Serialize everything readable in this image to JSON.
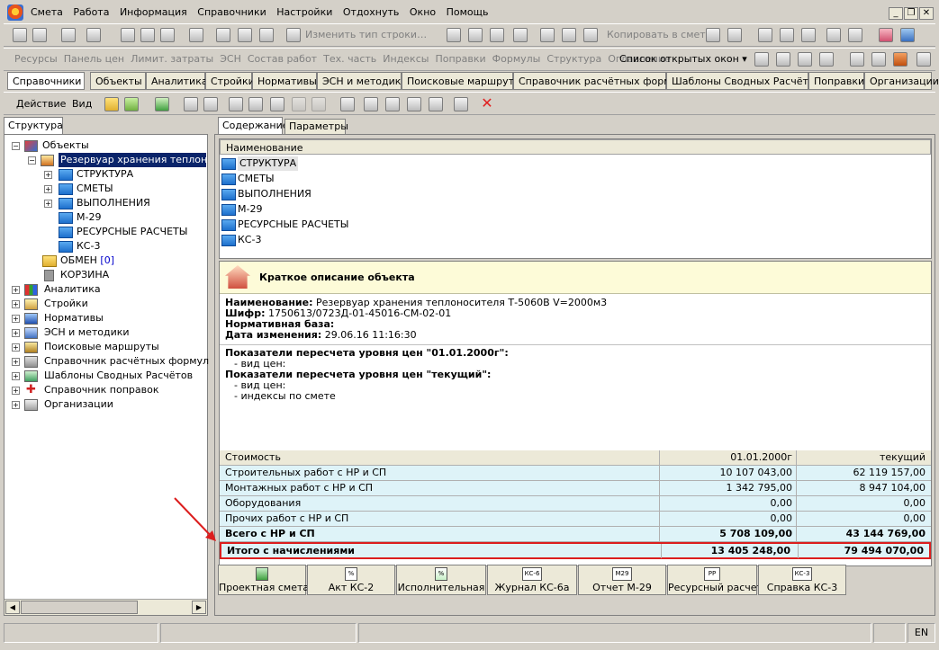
{
  "menubar": {
    "items": [
      "Смета",
      "Работа",
      "Информация",
      "Справочники",
      "Настройки",
      "Отдохнуть",
      "Окно",
      "Помощь"
    ]
  },
  "toolbar1": {
    "change_row_type": "Изменить тип строки…",
    "copy_to_estimate": "Копировать в смету"
  },
  "toolbar2": {
    "items": [
      "Ресурсы",
      "Панель цен",
      "Лимит. затраты",
      "ЭСН",
      "Состав работ",
      "Тех. часть",
      "Индексы",
      "Поправки",
      "Формулы",
      "Структура",
      "Оглавление"
    ],
    "open_windows": "Список открытых окон"
  },
  "ref_tabs": [
    "Справочники",
    "Объекты",
    "Аналитика",
    "Стройки",
    "Нормативы",
    "ЭСН и методики",
    "Поисковые маршруты",
    "Справочник расчётных формул",
    "Шаблоны Сводных Расчётов",
    "Поправки",
    "Организации"
  ],
  "action_bar": {
    "action": "Действие",
    "view": "Вид"
  },
  "left": {
    "tab": "Структура",
    "tree": {
      "objects": "Объекты",
      "reservoir": "Резервуар хранения теплоноси",
      "children": [
        "СТРУКТУРА",
        "СМЕТЫ",
        "ВЫПОЛНЕНИЯ",
        "М-29",
        "РЕСУРСНЫЕ РАСЧЕТЫ",
        "КС-3"
      ],
      "exchange": "ОБМЕН",
      "exchange_count": "[0]",
      "basket": "КОРЗИНА",
      "roots": [
        "Аналитика",
        "Стройки",
        "Нормативы",
        "ЭСН и методики",
        "Поисковые маршруты",
        "Справочник расчётных формул",
        "Шаблоны Сводных Расчётов",
        "Справочник поправок",
        "Организации"
      ]
    }
  },
  "right": {
    "tabs": [
      "Содержание",
      "Параметры"
    ],
    "list_header": "Наименование",
    "list": [
      "СТРУКТУРА",
      "СМЕТЫ",
      "ВЫПОЛНЕНИЯ",
      "М-29",
      "РЕСУРСНЫЕ РАСЧЕТЫ",
      "КС-3"
    ],
    "desc_title": "Краткое описание объекта",
    "desc": {
      "name_label": "Наименование:",
      "name_value": "Резервуар хранения теплоносителя Т-5060В V=2000м3",
      "code_label": "Шифр:",
      "code_value": "1750613/0723Д-01-45016-СМ-02-01",
      "base_label": "Нормативная база:",
      "date_label": "Дата изменения:",
      "date_value": "29.06.16 11:16:30"
    },
    "indicators": {
      "h1": "Показатели пересчета уровня цен \"01.01.2000г\":",
      "h1_items": [
        "- вид цен:"
      ],
      "h2": "Показатели пересчета уровня цен \"текущий\":",
      "h2_items": [
        "- вид цен:",
        "- индексы по смете"
      ]
    },
    "cost": {
      "headers": [
        "Стоимость",
        "01.01.2000г",
        "текущий"
      ],
      "rows": [
        {
          "name": "Строительных работ с НР и СП",
          "base": "10 107 043,00",
          "current": "62 119 157,00"
        },
        {
          "name": "Монтажных работ с НР и СП",
          "base": "1 342 795,00",
          "current": "8 947 104,00"
        },
        {
          "name": "Оборудования",
          "base": "0,00",
          "current": "0,00"
        },
        {
          "name": "Прочих работ с НР и СП",
          "base": "0,00",
          "current": "0,00"
        },
        {
          "name": "Всего с НР и СП",
          "base": "5 708 109,00",
          "current": "43 144 769,00"
        },
        {
          "name": "Итого с начислениями",
          "base": "13 405 248,00",
          "current": "79 494 070,00"
        }
      ]
    },
    "buttons": [
      "Проектная смета",
      "Акт КС-2",
      "Исполнительная",
      "Журнал КС-6а",
      "Отчет М-29",
      "Ресурсный расчет",
      "Справка КС-3"
    ],
    "button_icons": [
      "",
      "%",
      "%",
      "КС-6",
      "М29",
      "РР",
      "КС-3"
    ]
  },
  "status": {
    "lang": "EN"
  },
  "colors": {
    "highlight": "#dc1e1e",
    "cost_bg": "#def3f8",
    "desc_bg": "#fdfbd8",
    "selection": "#0a246a"
  }
}
